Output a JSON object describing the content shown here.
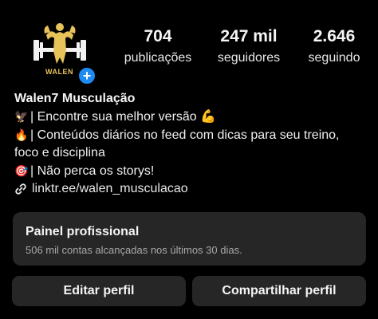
{
  "profile": {
    "avatar_text": "WALEN",
    "add_badge": "+",
    "stats": {
      "posts": {
        "value": "704",
        "label": "publicações"
      },
      "followers": {
        "value": "247 mil",
        "label": "seguidores"
      },
      "following": {
        "value": "2.646",
        "label": "seguindo"
      }
    },
    "name": "Walen7 Musculação",
    "bio": [
      {
        "emoji": "🦅",
        "text": "| Encontre sua melhor versão 💪"
      },
      {
        "emoji": "🔥",
        "text": "| Conteúdos diários no feed com dicas para seu treino,"
      },
      {
        "emoji": "",
        "text": "foco e disciplina"
      },
      {
        "emoji": "🎯",
        "text": "| Não perca os storys!"
      }
    ],
    "link": "linktr.ee/walen_musculacao"
  },
  "panel": {
    "title": "Painel profissional",
    "subtitle": "506 mil contas alcançadas nos últimos 30 dias."
  },
  "buttons": {
    "edit": "Editar perfil",
    "share": "Compartilhar perfil"
  },
  "colors": {
    "background": "#000000",
    "surface": "#262626",
    "accent_blue": "#1c8cf3",
    "logo_gold": "#e8c35a"
  }
}
